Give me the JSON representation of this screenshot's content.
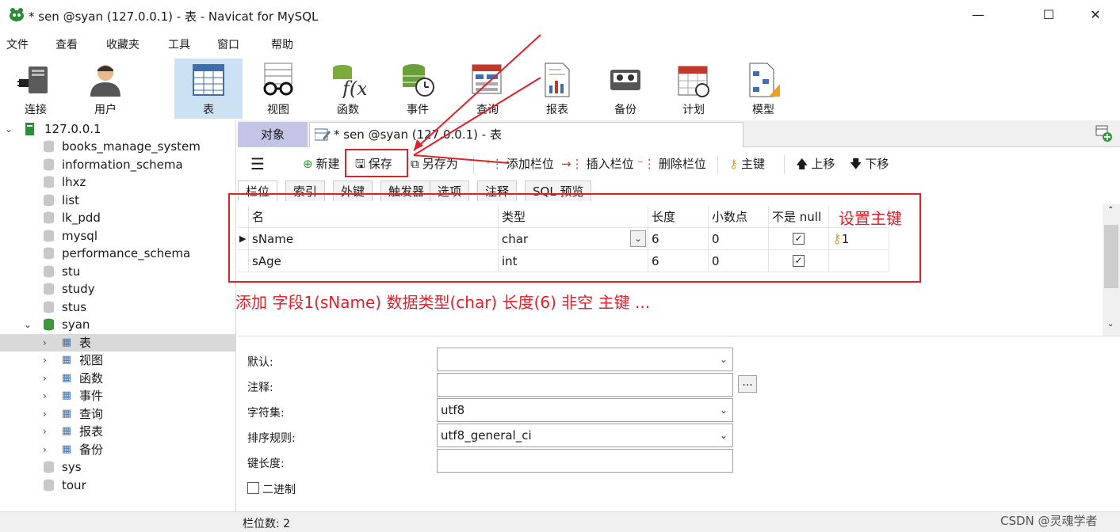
{
  "window": {
    "title": "* sen @syan (127.0.0.1) - 表 - Navicat for MySQL",
    "minimize": "—",
    "maximize": "☐",
    "close": "✕"
  },
  "menu": [
    "文件",
    "查看",
    "收藏夹",
    "工具",
    "窗口",
    "帮助"
  ],
  "toolbar": [
    {
      "label": "连接",
      "icon": "connection-plug-icon"
    },
    {
      "label": "用户",
      "icon": "user-icon"
    },
    {
      "label": "表",
      "icon": "table-icon",
      "selected": true
    },
    {
      "label": "视图",
      "icon": "view-glasses-icon"
    },
    {
      "label": "函数",
      "icon": "function-icon"
    },
    {
      "label": "事件",
      "icon": "event-clock-icon"
    },
    {
      "label": "查询",
      "icon": "query-icon"
    },
    {
      "label": "报表",
      "icon": "report-icon"
    },
    {
      "label": "备份",
      "icon": "backup-icon"
    },
    {
      "label": "计划",
      "icon": "schedule-icon"
    },
    {
      "label": "模型",
      "icon": "model-icon"
    }
  ],
  "tree": {
    "root": "127.0.0.1",
    "databases": [
      "books_manage_system",
      "information_schema",
      "lhxz",
      "list",
      "lk_pdd",
      "mysql",
      "performance_schema",
      "stu",
      "study",
      "stus",
      "syan",
      "sys",
      "tour"
    ],
    "open_db": "syan",
    "children": [
      {
        "label": "表",
        "icon": "table-icon",
        "selected": true
      },
      {
        "label": "视图",
        "icon": "view-glasses-icon"
      },
      {
        "label": "函数",
        "icon": "function-icon"
      },
      {
        "label": "事件",
        "icon": "event-clock-icon"
      },
      {
        "label": "查询",
        "icon": "query-icon"
      },
      {
        "label": "报表",
        "icon": "report-icon"
      },
      {
        "label": "备份",
        "icon": "backup-icon"
      }
    ]
  },
  "tabs": {
    "objects": "对象",
    "editor": "* sen @syan (127.0.0.1) - 表",
    "add_icon": "add-tab-icon"
  },
  "editor_toolbar": {
    "menu_icon": "hamburger-icon",
    "new": "新建",
    "save": "保存",
    "save_as": "另存为",
    "add_field": "添加栏位",
    "insert_field": "插入栏位",
    "delete_field": "删除栏位",
    "primary_key": "主键",
    "move_up": "上移",
    "move_down": "下移"
  },
  "subtabs": [
    "栏位",
    "索引",
    "外键",
    "触发器",
    "选项",
    "注释",
    "SQL 预览"
  ],
  "grid": {
    "headers": [
      "名",
      "类型",
      "长度",
      "小数点",
      "不是 null",
      ""
    ],
    "rows": [
      {
        "name": "sName",
        "type": "char",
        "length": "6",
        "decimals": "0",
        "not_null": true,
        "key": "1",
        "current": true
      },
      {
        "name": "sAge",
        "type": "int",
        "length": "6",
        "decimals": "0",
        "not_null": true,
        "key": "",
        "current": false
      }
    ]
  },
  "props": {
    "default_label": "默认:",
    "default_value": "",
    "comment_label": "注释:",
    "comment_value": "",
    "comment_more": "...",
    "charset_label": "字符集:",
    "charset_value": "utf8",
    "collation_label": "排序规则:",
    "collation_value": "utf8_general_ci",
    "keylen_label": "键长度:",
    "keylen_value": "",
    "binary_label": "二进制"
  },
  "status": {
    "field_count": "栏位数: 2",
    "watermark": "CSDN @灵魂学者"
  },
  "annotations": {
    "set_pk": "设置主键",
    "explain": "添加 字段1(sName)  数据类型(char) 长度(6)  非空  主键  ...",
    "color": "#e0202a"
  }
}
